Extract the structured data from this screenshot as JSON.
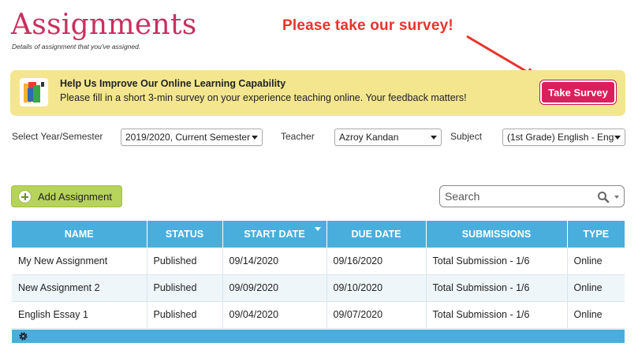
{
  "page": {
    "title": "Assignments",
    "subtitle": "Details of assignment that you've assigned."
  },
  "annotation": {
    "text": "Please take our survey!",
    "color": "#e8342a"
  },
  "banner": {
    "heading": "Help Us Improve Our Online Learning Capability",
    "text": "Please fill in a short 3-min survey on your experience teaching online. Your feedback matters!",
    "button_label": "Take Survey",
    "logo_icon": "colorful-book-logo-icon",
    "bg_color": "#f3e68e",
    "button_color": "#dd1e5d"
  },
  "filters": {
    "year_label": "Select Year/Semester",
    "year_value": "2019/2020, Current Semester",
    "teacher_label": "Teacher",
    "teacher_value": "Azroy Kandan",
    "subject_label": "Subject",
    "subject_value": "(1st Grade) English - Eng"
  },
  "toolbar": {
    "add_label": "Add Assignment",
    "add_icon": "plus-circle-icon",
    "search_placeholder": "Search",
    "search_icon": "search-icon"
  },
  "table": {
    "header_color": "#4aaedd",
    "columns": [
      "NAME",
      "STATUS",
      "START DATE",
      "DUE DATE",
      "SUBMISSIONS",
      "TYPE"
    ],
    "sorted_column": "START DATE",
    "rows": [
      [
        "My New Assignment",
        "Published",
        "09/14/2020",
        "09/16/2020",
        "Total Submission - 1/6",
        "Online"
      ],
      [
        "New Assignment 2",
        "Published",
        "09/09/2020",
        "09/10/2020",
        "Total Submission - 1/6",
        "Online"
      ],
      [
        "English Essay 1",
        "Published",
        "09/04/2020",
        "09/07/2020",
        "Total Submission - 1/6",
        "Online"
      ]
    ],
    "footer_icon": "gear-icon"
  }
}
